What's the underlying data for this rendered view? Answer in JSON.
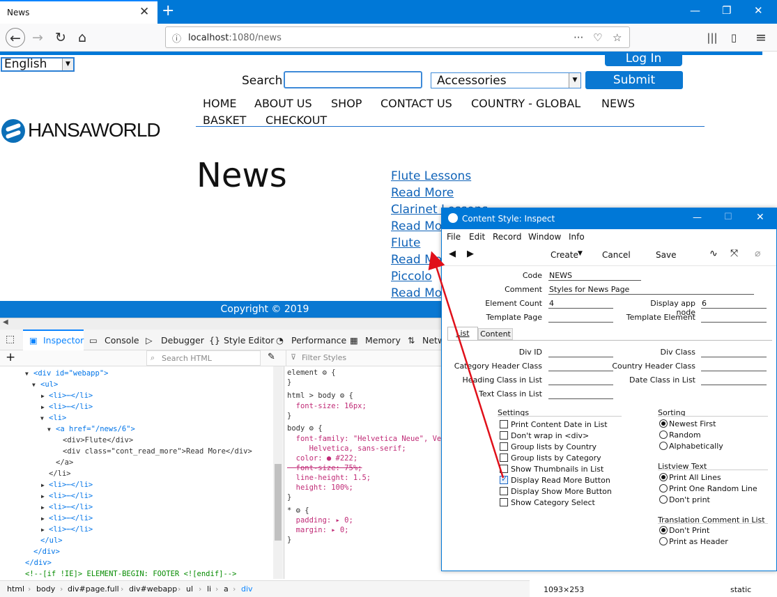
{
  "browser": {
    "tab_title": "News",
    "url_prefix": "localhost",
    "url_rest": ":1080/news"
  },
  "site": {
    "language": "English",
    "login_label": "Log In",
    "search_label": "Search",
    "category": "Accessories",
    "submit_label": "Submit",
    "menu_row1": [
      "HOME",
      "ABOUT US",
      "SHOP",
      "CONTACT US",
      "COUNTRY - GLOBAL",
      "NEWS"
    ],
    "menu_row2": [
      "BASKET",
      "CHECKOUT"
    ],
    "logo_text": "HANSAWORLD",
    "page_heading": "News",
    "news_links": [
      "Flute Lessons",
      "Read More",
      "Clarinet Lessons",
      "Read More",
      "Flute",
      "Read More",
      "Piccolo",
      "Read More"
    ],
    "footer": "Copyright © 2019"
  },
  "devtools": {
    "tabs": [
      "Inspector",
      "Console",
      "Debugger",
      "Style Editor",
      "Performance",
      "Memory",
      "Netw"
    ],
    "search_placeholder": "Search HTML",
    "filter_placeholder": "Filter Styles",
    "html_lines": [
      "<div id=\"webapp\">",
      "<ul>",
      "<li>⋯</li>",
      "<li>⋯</li>",
      "<li>",
      "<a href=\"/news/6\">",
      "<div>Flute</div>",
      "<div class=\"cont_read_more\">Read More</div>",
      "</a>",
      "</li>",
      "<li>⋯</li>",
      "<li>⋯</li>",
      "<li>⋯</li>",
      "<li>⋯</li>",
      "<li>⋯</li>",
      "</ul>",
      "</div>",
      "</div>",
      "<!--[if !IE]> ELEMENT-BEGIN: FOOTER <![endif]-->"
    ],
    "css_lines": [
      "element ⚙ {",
      "}",
      "html > body ⚙ {",
      "  font-size: 16px;",
      "}",
      "body ⚙ {",
      "  font-family: \"Helvetica Neue\", Ver",
      "     Helvetica, sans-serif;",
      "  color: ● #222;",
      "  font-size: 75%;",
      "  line-height: 1.5;",
      "  height: 100%;",
      "}",
      "* ⚙ {",
      "  padding: ▸ 0;",
      "  margin: ▸ 0;",
      "}"
    ],
    "breadcrumbs": [
      "html",
      "body",
      "div#page.full",
      "div#webapp",
      "ul",
      "li",
      "a",
      "div"
    ],
    "size_readout": "1093×253",
    "position": "static"
  },
  "dialog": {
    "title": "Content Style: Inspect",
    "menu": [
      "File",
      "Edit",
      "Record",
      "Window",
      "Info"
    ],
    "toolbar": {
      "create": "Create",
      "cancel": "Cancel",
      "save": "Save"
    },
    "code_label": "Code",
    "code_value": "NEWS",
    "comment_label": "Comment",
    "comment_value": "Styles for News Page",
    "element_count_label": "Element Count",
    "element_count_value": "4",
    "display_app_node_label": "Display app node",
    "display_app_node_value": "6",
    "template_page_label": "Template Page",
    "template_element_label": "Template Element",
    "tabs": [
      "List",
      "Content"
    ],
    "div_id_label": "Div ID",
    "div_class_label": "Div Class",
    "category_header_label": "Category Header Class",
    "country_header_label": "Country Header Class",
    "heading_class_label": "Heading Class in List",
    "date_class_label": "Date Class in List",
    "text_class_label": "Text Class in List",
    "settings_title": "Settings",
    "settings": [
      {
        "label": "Print Content Date in List",
        "checked": false
      },
      {
        "label": "Don't wrap in <div>",
        "checked": false
      },
      {
        "label": "Group lists by Country",
        "checked": false
      },
      {
        "label": "Group lists by Category",
        "checked": false
      },
      {
        "label": "Show Thumbnails in List",
        "checked": false
      },
      {
        "label": "Display Read More Button",
        "checked": true
      },
      {
        "label": "Display Show More Button",
        "checked": false
      },
      {
        "label": "Show Category Select",
        "checked": false
      }
    ],
    "sorting_title": "Sorting",
    "sorting": [
      {
        "label": "Newest First",
        "selected": true
      },
      {
        "label": "Random",
        "selected": false
      },
      {
        "label": "Alphabetically",
        "selected": false
      }
    ],
    "listview_title": "Listview Text",
    "listview": [
      {
        "label": "Print All Lines",
        "selected": true
      },
      {
        "label": "Print One Random Line",
        "selected": false
      },
      {
        "label": "Don't print",
        "selected": false
      }
    ],
    "translation_title": "Translation Comment in List",
    "translation": [
      {
        "label": "Don't Print",
        "selected": true
      },
      {
        "label": "Print as Header",
        "selected": false
      }
    ]
  },
  "colors": {
    "accent": "#0078d7",
    "link": "#1063b8",
    "arrow": "#e0101a"
  }
}
